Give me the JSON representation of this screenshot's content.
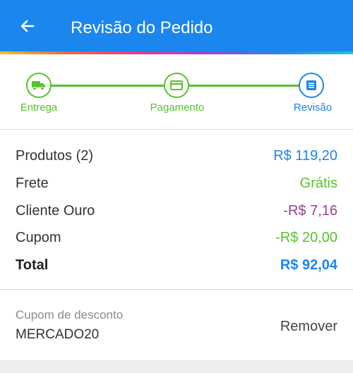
{
  "header": {
    "title": "Revisão do Pedido",
    "back_icon": "arrow-left-icon"
  },
  "stepper": {
    "steps": [
      {
        "label": "Entrega",
        "icon": "truck-icon",
        "state": "done"
      },
      {
        "label": "Pagamento",
        "icon": "credit-card-icon",
        "state": "done"
      },
      {
        "label": "Revisão",
        "icon": "list-document-icon",
        "state": "active"
      }
    ]
  },
  "summary": {
    "rows": [
      {
        "label": "Produtos (2)",
        "value": "R$ 119,20"
      },
      {
        "label": "Frete",
        "value": "Grátis"
      },
      {
        "label": "Cliente Ouro",
        "value": "-R$ 7,16"
      },
      {
        "label": "Cupom",
        "value": "-R$ 20,00"
      },
      {
        "label": "Total",
        "value": "R$ 92,04"
      }
    ]
  },
  "coupon": {
    "label": "Cupom de desconto",
    "code": "MERCADO20",
    "remove_label": "Remover"
  },
  "colors": {
    "primary": "#1a86ee",
    "success": "#56c22e",
    "gold_discount": "#9b3e9a"
  }
}
